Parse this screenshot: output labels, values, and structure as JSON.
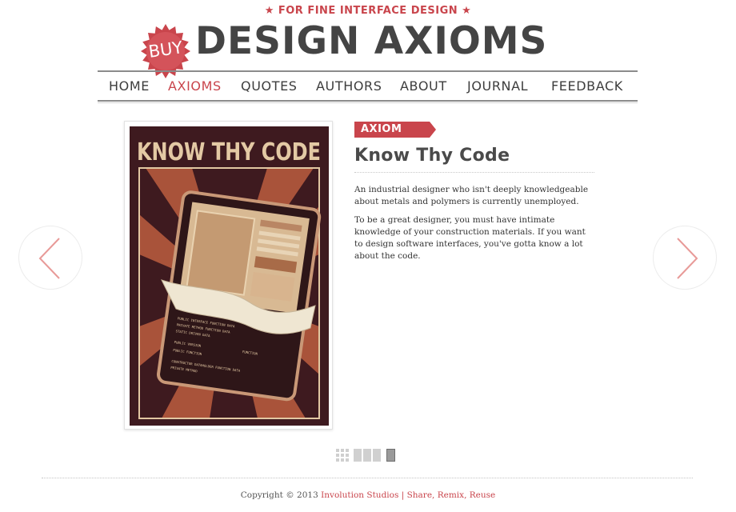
{
  "header": {
    "tagline": "★ FOR FINE INTERFACE DESIGN ★",
    "buy_label": "BUY",
    "site_title": "DESIGN AXIOMS",
    "brand_color": "#c9454c"
  },
  "nav": {
    "items": [
      {
        "label": "HOME",
        "active": false
      },
      {
        "label": "AXIOMS",
        "active": true
      },
      {
        "label": "QUOTES",
        "active": false
      },
      {
        "label": "AUTHORS",
        "active": false
      },
      {
        "label": "ABOUT",
        "active": false
      },
      {
        "label": "JOURNAL",
        "active": false
      },
      {
        "label": "FEEDBACK",
        "active": false
      }
    ]
  },
  "carousel": {
    "prev_icon": "chevron-left-icon",
    "next_icon": "chevron-right-icon"
  },
  "poster": {
    "headline": "KNOW THY CODE",
    "screen_code_lines": [
      "PUBLIC INTERFACE FUNCTION DATA",
      "PRIVATE METHOD FUNCTION DATA",
      "STATIC DRIVEN DATA",
      "PUBLIC VERSION",
      "FUNCTION",
      "PUBLIC FUNCTION",
      "CONSTRUCTOR DATAHOLDER FUNCTION DATA",
      "PRIVATE METHOD"
    ]
  },
  "article": {
    "tag": "AXIOM",
    "title": "Know Thy Code",
    "paragraphs": [
      "An industrial designer who isn't deeply knowledgeable about metals and polymers is currently unemployed.",
      "To be a great designer, you must have intimate knowledge of your construction materials. If you want to design software interfaces, you've gotta know a lot about the code."
    ]
  },
  "view_switcher": {
    "options": [
      "grid-view-icon",
      "filmstrip-view-icon",
      "single-view-icon"
    ],
    "selected": "single-view-icon"
  },
  "footer": {
    "copyright": "Copyright © 2013",
    "company_link": "Involution Studios",
    "separator": "|",
    "license_link": "Share, Remix, Reuse"
  }
}
